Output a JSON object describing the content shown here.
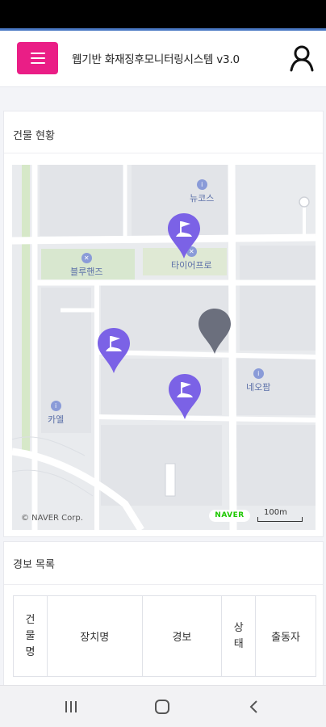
{
  "header": {
    "title": "웹기반 화재징후모니터링시스템 v3.0",
    "menu_icon": "hamburger-menu-icon",
    "user_icon": "user-icon"
  },
  "building_status": {
    "title": "건물 현황",
    "map": {
      "pois": [
        "뉴코스",
        "블루핸즈",
        "타이어프로",
        "네오팜",
        "카엘"
      ],
      "copyright": "© NAVER Corp.",
      "brand": "NAVER",
      "scale": "100m",
      "marker_icon": "flag-pin-icon",
      "marker_color": "#7b62e6",
      "selected_marker_color": "#6b6f7d"
    }
  },
  "alarm_list": {
    "title": "경보 목록",
    "columns": [
      "건물명",
      "장치명",
      "경보",
      "상태",
      "출동자"
    ]
  },
  "colors": {
    "menu_button": "#ea1e86",
    "accent_line": "#4a78c4"
  }
}
